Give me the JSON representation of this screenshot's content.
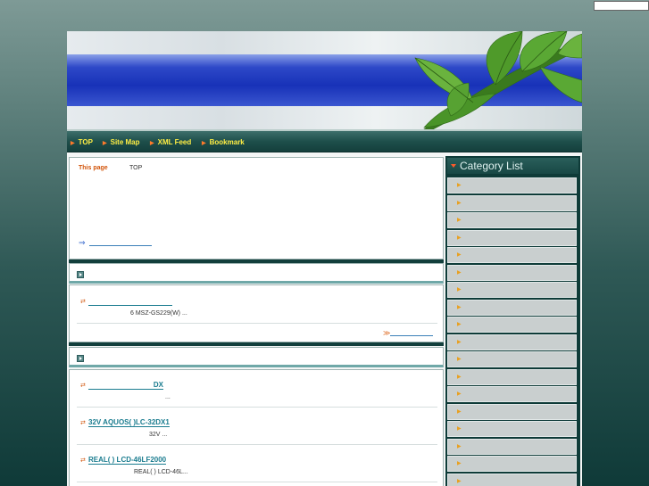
{
  "search": {
    "placeholder": ""
  },
  "nav": {
    "items": [
      {
        "label": "TOP"
      },
      {
        "label": "Site Map"
      },
      {
        "label": "XML Feed"
      },
      {
        "label": "Bookmark"
      }
    ]
  },
  "this_page": {
    "label": "This page",
    "value": "TOP"
  },
  "intro": {
    "link_arrow": "⇒"
  },
  "section1": {
    "entries": [
      {
        "bullet": "⇄",
        "title": "",
        "desc": "6  MSZ-GS229(W)    ..."
      }
    ],
    "more_arrow": "≫"
  },
  "section2": {
    "entries": [
      {
        "bullet": "⇄",
        "title": "DX",
        "desc": "..."
      },
      {
        "bullet": "⇄",
        "title": "32V         AQUOS(       )LC-32DX1",
        "desc": "32V      ..."
      },
      {
        "bullet": "⇄",
        "title": "REAL(      )  LCD-46LF2000",
        "desc": "REAL(   )  LCD-46L..."
      }
    ]
  },
  "sidebar": {
    "title": "Category List",
    "items": [
      "",
      "",
      "",
      "",
      "",
      "",
      "",
      "",
      "",
      "",
      "",
      "",
      "",
      "",
      "",
      "",
      "",
      ""
    ]
  },
  "colors": {
    "accent_orange": "#d2540a",
    "nav_text": "#ffee44",
    "link_teal": "#1a7c8f",
    "sidebar_bg": "#0e3b38"
  }
}
